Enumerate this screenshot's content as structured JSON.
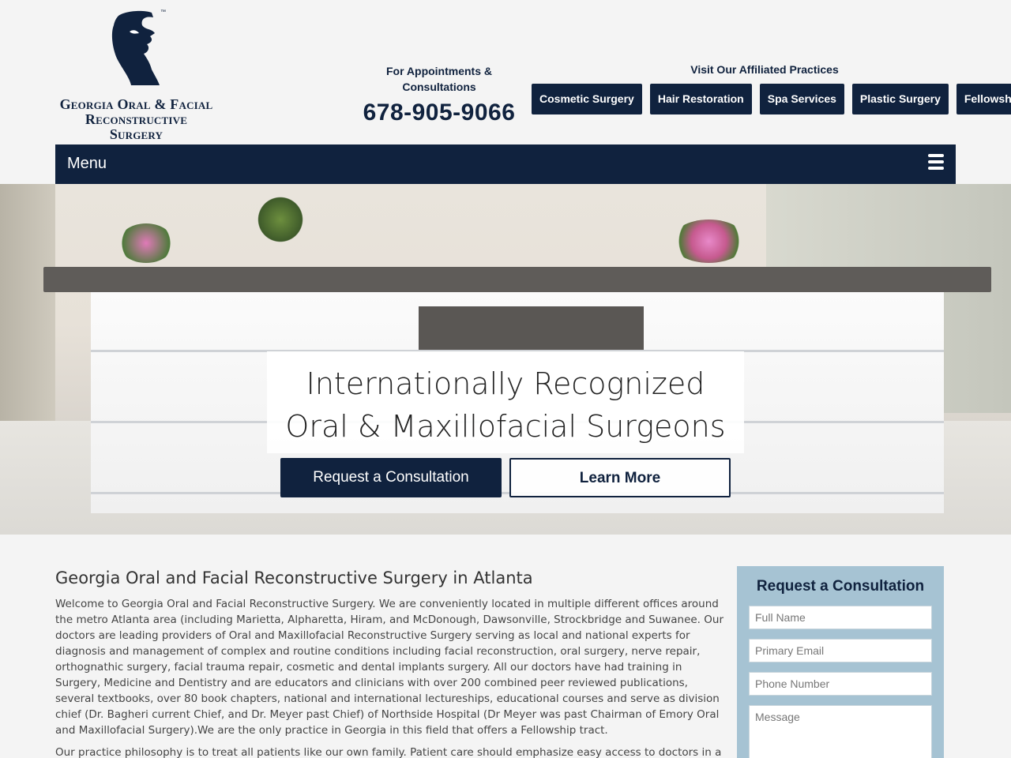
{
  "header": {
    "logo": {
      "brand_lines": [
        "Georgia Oral & Facial",
        "Reconstructive",
        "Surgery"
      ],
      "trademark": "™"
    },
    "appointments": {
      "label": "For Appointments & Consultations",
      "phone": "678-905-9066"
    },
    "affiliated": {
      "label": "Visit Our Affiliated Practices",
      "links": [
        "Cosmetic Surgery",
        "Hair Restoration",
        "Spa Services",
        "Plastic Surgery",
        "Fellowship"
      ]
    }
  },
  "nav": {
    "menu_label": "Menu",
    "menu_icon": "hamburger-icon"
  },
  "hero": {
    "headline_lines": [
      "Internationally Recognized",
      "Oral & Maxillofacial Surgeons"
    ],
    "primary_button": "Request a Consultation",
    "secondary_button": "Learn More"
  },
  "main": {
    "title": "Georgia Oral and Facial Reconstructive Surgery in Atlanta",
    "paragraphs": [
      "Welcome to Georgia Oral and Facial Reconstructive Surgery. We are conveniently located in multiple different offices around the metro Atlanta area (including Marietta, Alpharetta, Hiram, and McDonough, Dawsonville, Strockbridge and Suwanee. Our doctors are leading providers of Oral and Maxillofacial Reconstructive Surgery serving as local and national experts for diagnosis and management of complex and routine conditions including facial reconstruction, oral surgery, nerve repair, orthognathic surgery, facial trauma repair, cosmetic and dental implants surgery. All our doctors have had training in Surgery, Medicine and Dentistry and are educators and clinicians with over 200 combined peer reviewed publications, several textbooks, over 80 book chapters, national and international lectureships, educational courses and serve as division chief (Dr. Bagheri current Chief, and Dr. Meyer past Chief) of Northside Hospital (Dr Meyer was past Chairman of Emory Oral and Maxillofacial Surgery).We are the only practice in Georgia in this field that offers a Fellowship tract.",
      "Our practice philosophy is to treat all patients like our own family. Patient care should emphasize easy access to doctors in a"
    ]
  },
  "consultation_form": {
    "title": "Request a Consultation",
    "fields": {
      "name_placeholder": "Full Name",
      "email_placeholder": "Primary Email",
      "phone_placeholder": "Phone Number",
      "message_placeholder": "Message"
    }
  },
  "colors": {
    "brand_navy": "#10223e",
    "form_bg": "#a6c3d3",
    "page_bg": "#f4f4f4"
  }
}
